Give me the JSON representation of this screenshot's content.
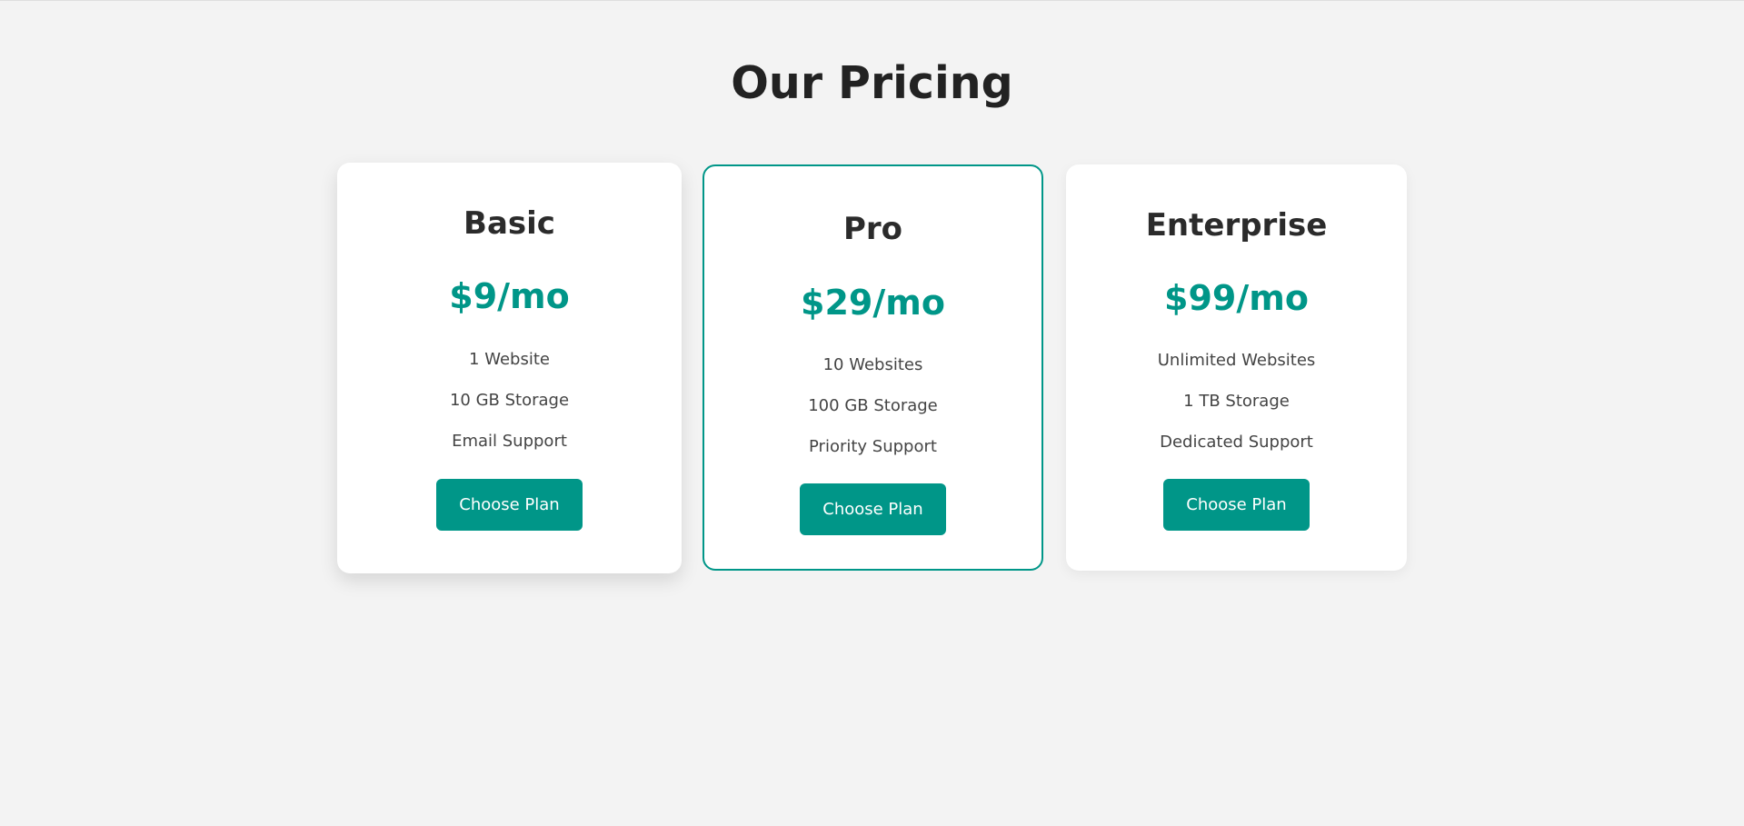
{
  "page": {
    "title": "Our Pricing"
  },
  "colors": {
    "accent": "#009688",
    "background": "#f3f3f3",
    "card": "#ffffff",
    "heading": "#222222"
  },
  "plans": [
    {
      "name": "Basic",
      "price": "$9/mo",
      "features": [
        "1 Website",
        "10 GB Storage",
        "Email Support"
      ],
      "button_label": "Choose Plan",
      "highlighted": false
    },
    {
      "name": "Pro",
      "price": "$29/mo",
      "features": [
        "10 Websites",
        "100 GB Storage",
        "Priority Support"
      ],
      "button_label": "Choose Plan",
      "highlighted": true
    },
    {
      "name": "Enterprise",
      "price": "$99/mo",
      "features": [
        "Unlimited Websites",
        "1 TB Storage",
        "Dedicated Support"
      ],
      "button_label": "Choose Plan",
      "highlighted": false
    }
  ]
}
